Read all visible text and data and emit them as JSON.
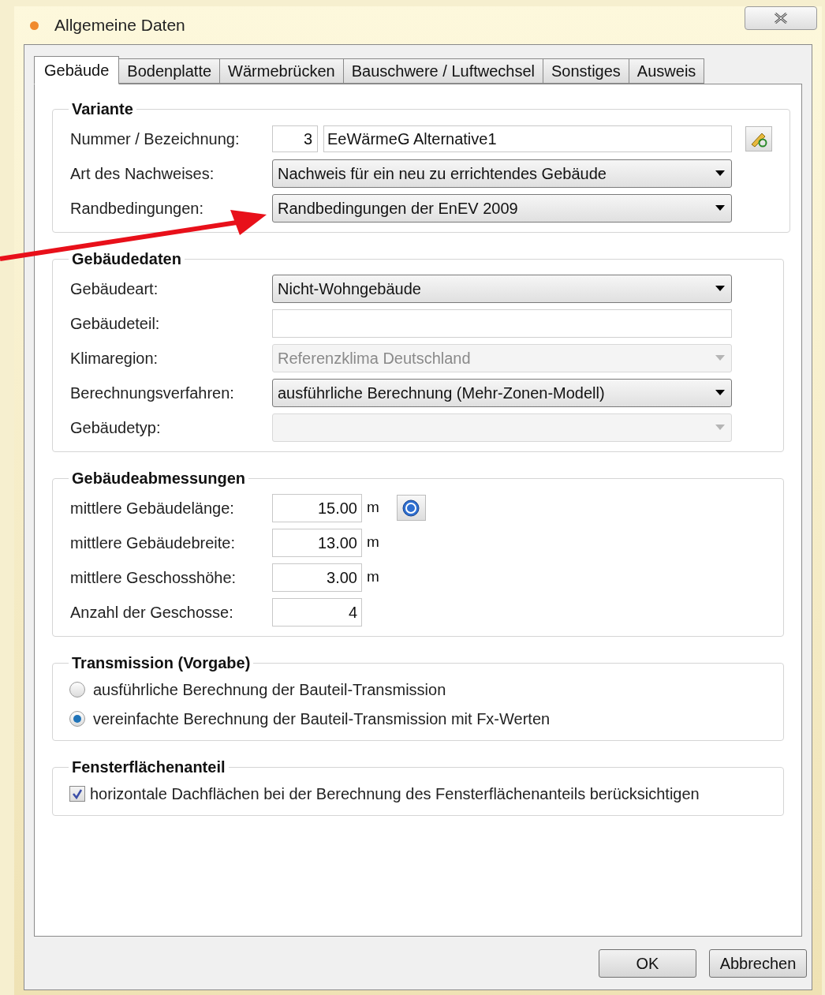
{
  "window": {
    "title": "Allgemeine Daten"
  },
  "tabs": [
    {
      "label": "Gebäude",
      "selected": true
    },
    {
      "label": "Bodenplatte",
      "selected": false
    },
    {
      "label": "Wärmebrücken",
      "selected": false
    },
    {
      "label": "Bauschwere / Luftwechsel",
      "selected": false
    },
    {
      "label": "Sonstiges",
      "selected": false
    },
    {
      "label": "Ausweis",
      "selected": false
    }
  ],
  "groups": [
    {
      "title": "Variante",
      "fields": [
        {
          "kind": "number_name",
          "label": "Nummer / Bezeichnung:",
          "number": "3",
          "value": "EeWärmeG Alternative1"
        },
        {
          "kind": "dropdown",
          "label": "Art des Nachweises:",
          "value": "Nachweis für ein neu zu errichtendes Gebäude",
          "disabled": false
        },
        {
          "kind": "dropdown",
          "label": "Randbedingungen:",
          "value": "Randbedingungen der EnEV 2009",
          "disabled": false
        }
      ]
    },
    {
      "title": "Gebäudedaten",
      "fields": [
        {
          "kind": "dropdown",
          "label": "Gebäudeart:",
          "value": "Nicht-Wohngebäude",
          "disabled": false
        },
        {
          "kind": "text",
          "label": "Gebäudeteil:"
        },
        {
          "kind": "dropdown",
          "label": "Klimaregion:",
          "value": "Referenzklima Deutschland",
          "disabled": true
        },
        {
          "kind": "dropdown",
          "label": "Berechnungsverfahren:",
          "value": "ausführliche Berechnung (Mehr-Zonen-Modell)",
          "disabled": false
        },
        {
          "kind": "dropdown",
          "label": "Gebäudetyp:",
          "disabled": true
        }
      ]
    },
    {
      "title": "Gebäudeabmessungen",
      "fields": [
        {
          "kind": "number",
          "label": "mittlere Gebäudelänge:",
          "value": "15.00",
          "unit": "m",
          "help": true
        },
        {
          "kind": "number",
          "label": "mittlere Gebäudebreite:",
          "value": "13.00",
          "unit": "m",
          "help": false
        },
        {
          "kind": "number",
          "label": "mittlere Geschosshöhe:",
          "value": "3.00",
          "unit": "m",
          "help": false
        },
        {
          "kind": "number",
          "label": "Anzahl der Geschosse:",
          "value": "4",
          "help": false
        }
      ]
    },
    {
      "title": "Transmission (Vorgabe)",
      "fields": [
        {
          "kind": "radio",
          "label": "ausführliche Berechnung der Bauteil-Transmission",
          "selected": false
        },
        {
          "kind": "radio",
          "label": "vereinfachte Berechnung der Bauteil-Transmission mit Fx-Werten",
          "selected": true
        }
      ]
    },
    {
      "title": "Fensterflächenanteil",
      "fields": [
        {
          "kind": "checkbox",
          "label": "horizontale Dachflächen bei der Berechnung des Fensterflächenanteils berücksichtigen",
          "checked": true
        }
      ]
    }
  ],
  "buttons": [
    "OK",
    "Abbrechen"
  ]
}
